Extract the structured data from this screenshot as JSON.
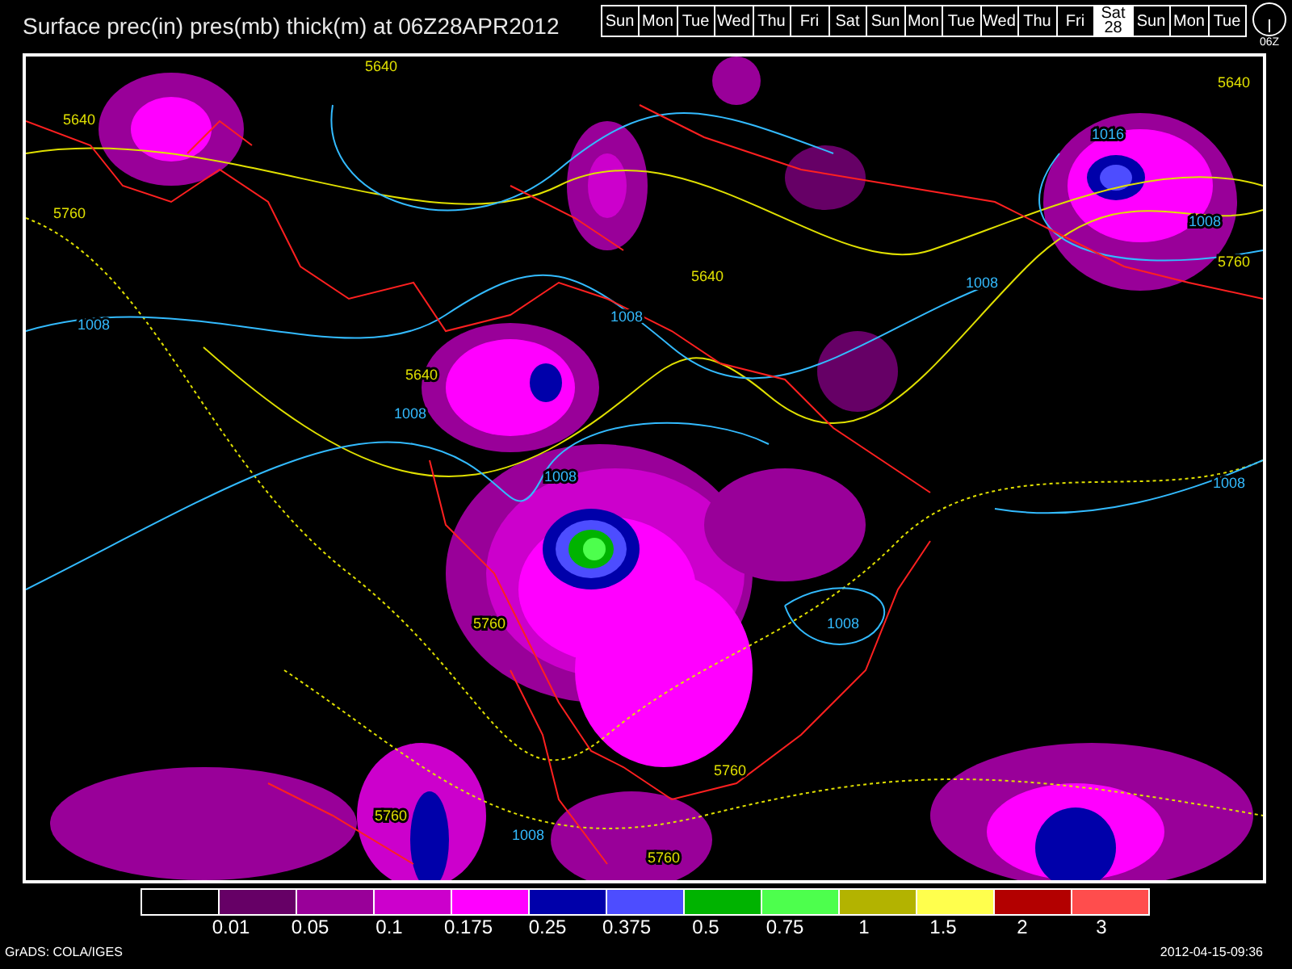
{
  "title": "Surface prec(in) pres(mb) thick(m) at 06Z28APR2012",
  "days": [
    {
      "day": "Sun",
      "selected": false
    },
    {
      "day": "Mon",
      "selected": false
    },
    {
      "day": "Tue",
      "selected": false
    },
    {
      "day": "Wed",
      "selected": false
    },
    {
      "day": "Thu",
      "selected": false
    },
    {
      "day": "Fri",
      "selected": false
    },
    {
      "day": "Sat",
      "selected": false
    },
    {
      "day": "Sun",
      "selected": false
    },
    {
      "day": "Mon",
      "selected": false
    },
    {
      "day": "Tue",
      "selected": false
    },
    {
      "day": "Wed",
      "selected": false
    },
    {
      "day": "Thu",
      "selected": false
    },
    {
      "day": "Fri",
      "selected": false
    },
    {
      "day": "Sat",
      "date": "28",
      "selected": true
    },
    {
      "day": "Sun",
      "selected": false
    },
    {
      "day": "Mon",
      "selected": false
    },
    {
      "day": "Tue",
      "selected": false
    }
  ],
  "clock_label": "06Z",
  "contour_labels": [
    {
      "text": "5640",
      "kind": "thickness"
    },
    {
      "text": "5640",
      "kind": "thickness"
    },
    {
      "text": "5640",
      "kind": "thickness"
    },
    {
      "text": "1016",
      "kind": "pressure"
    },
    {
      "text": "5760",
      "kind": "thickness"
    },
    {
      "text": "1008",
      "kind": "pressure"
    },
    {
      "text": "5760",
      "kind": "thickness"
    },
    {
      "text": "5640",
      "kind": "thickness"
    },
    {
      "text": "1008",
      "kind": "pressure"
    },
    {
      "text": "1008",
      "kind": "pressure"
    },
    {
      "text": "1008",
      "kind": "pressure"
    },
    {
      "text": "5640",
      "kind": "thickness"
    },
    {
      "text": "1008",
      "kind": "pressure"
    },
    {
      "text": "1008",
      "kind": "pressure"
    },
    {
      "text": "1008",
      "kind": "pressure"
    },
    {
      "text": "5760",
      "kind": "thickness"
    },
    {
      "text": "1008",
      "kind": "pressure"
    },
    {
      "text": "5760",
      "kind": "thickness"
    },
    {
      "text": "5760",
      "kind": "thickness"
    },
    {
      "text": "1008",
      "kind": "pressure"
    },
    {
      "text": "5760",
      "kind": "thickness"
    }
  ],
  "legend": {
    "colors": [
      {
        "color": "#000000"
      },
      {
        "color": "#660066"
      },
      {
        "color": "#990099"
      },
      {
        "color": "#cc00cc"
      },
      {
        "color": "#ff00ff"
      },
      {
        "color": "#0000aa"
      },
      {
        "color": "#4d4dff"
      },
      {
        "color": "#00b300"
      },
      {
        "color": "#4dff4d"
      },
      {
        "color": "#b3b300"
      },
      {
        "color": "#ffff4d"
      },
      {
        "color": "#b30000"
      },
      {
        "color": "#ff4d4d"
      }
    ],
    "labels": [
      "0.01",
      "0.05",
      "0.1",
      "0.175",
      "0.25",
      "0.375",
      "0.5",
      "0.75",
      "1",
      "1.5",
      "2",
      "3"
    ]
  },
  "footer_left": "GrADS: COLA/IGES",
  "footer_right": "2012-04-15-09:36"
}
